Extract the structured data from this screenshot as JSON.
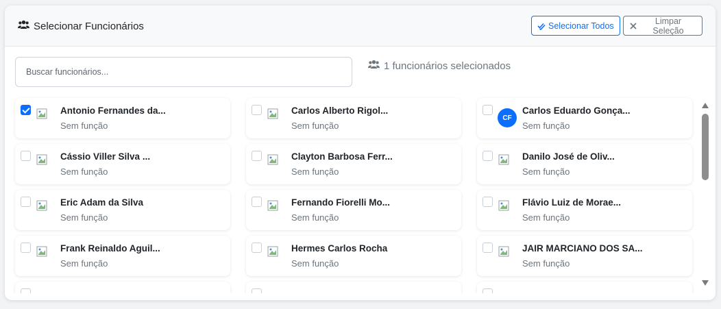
{
  "header": {
    "title": "Selecionar Funcionários",
    "select_all_label": "Selecionar Todos",
    "clear_label": "Limpar Seleção"
  },
  "search": {
    "placeholder": "Buscar funcionários...",
    "value": ""
  },
  "selection": {
    "count_text": "1 funcionários selecionados"
  },
  "colors": {
    "accent": "#0d6efd",
    "muted": "#6c757d"
  },
  "employees": [
    {
      "name": "Antonio Fernandes da...",
      "role": "Sem função",
      "checked": true,
      "avatar": "broken-image-icon"
    },
    {
      "name": "Carlos Alberto Rigol...",
      "role": "Sem função",
      "checked": false,
      "avatar": "broken-image-icon"
    },
    {
      "name": "Carlos Eduardo Gonça...",
      "role": "Sem função",
      "checked": false,
      "avatar_initials": "CF"
    },
    {
      "name": "Cássio Viller Silva ...",
      "role": "Sem função",
      "checked": false,
      "avatar": "broken-image-icon"
    },
    {
      "name": "Clayton Barbosa Ferr...",
      "role": "Sem função",
      "checked": false,
      "avatar": "broken-image-icon"
    },
    {
      "name": "Danilo José de Oliv...",
      "role": "Sem função",
      "checked": false,
      "avatar": "broken-image-icon"
    },
    {
      "name": "Eric Adam da Silva",
      "role": "Sem função",
      "checked": false,
      "avatar": "broken-image-icon"
    },
    {
      "name": "Fernando Fiorelli Mo...",
      "role": "Sem função",
      "checked": false,
      "avatar": "broken-image-icon"
    },
    {
      "name": "Flávio Luiz de Morae...",
      "role": "Sem função",
      "checked": false,
      "avatar": "broken-image-icon"
    },
    {
      "name": "Frank Reinaldo Aguil...",
      "role": "Sem função",
      "checked": false,
      "avatar": "broken-image-icon"
    },
    {
      "name": "Hermes Carlos Rocha",
      "role": "Sem função",
      "checked": false,
      "avatar": "broken-image-icon"
    },
    {
      "name": "JAIR MARCIANO DOS SA...",
      "role": "Sem função",
      "checked": false,
      "avatar": "broken-image-icon"
    }
  ]
}
